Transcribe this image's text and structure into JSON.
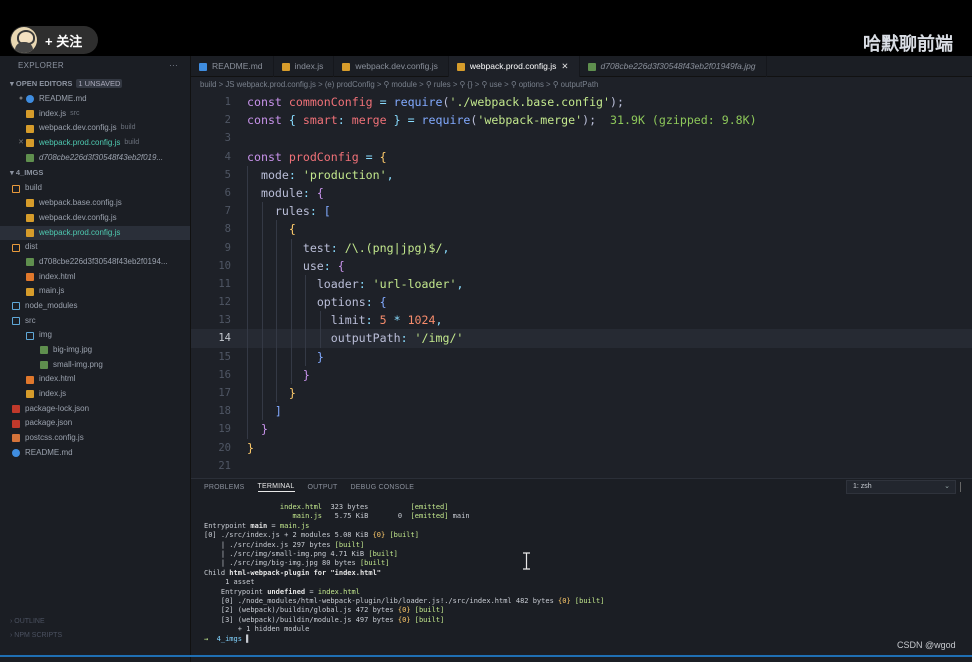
{
  "follow": {
    "label": "+ 关注"
  },
  "watermark": "哈默聊前端",
  "footer_credit": "CSDN @wgod",
  "sidebar": {
    "title": "EXPLORER",
    "more": "···",
    "open_editors": {
      "label": "OPEN EDITORS",
      "badge": "1 UNSAVED",
      "items": [
        {
          "mark": "●",
          "icon": "info-icon",
          "name": "README.md",
          "detail": ""
        },
        {
          "mark": "",
          "icon": "js-icon",
          "name": "index.js",
          "detail": "src"
        },
        {
          "mark": "",
          "icon": "js-icon",
          "name": "webpack.dev.config.js",
          "detail": "build"
        },
        {
          "mark": "✕",
          "icon": "js-icon",
          "name": "webpack.prod.config.js",
          "detail": "build"
        },
        {
          "mark": "",
          "icon": "image-icon",
          "name": "d708cbe226d3f30548f43eb2f019...",
          "detail": ""
        }
      ]
    },
    "project": {
      "label": "4_IMGS",
      "items": [
        {
          "indent": 0,
          "icon": "folder-icon",
          "name": "build"
        },
        {
          "indent": 1,
          "icon": "js-icon",
          "name": "webpack.base.config.js"
        },
        {
          "indent": 1,
          "icon": "js-icon",
          "name": "webpack.dev.config.js"
        },
        {
          "indent": 1,
          "icon": "js-icon",
          "name": "webpack.prod.config.js",
          "active": true
        },
        {
          "indent": 0,
          "icon": "folder-icon",
          "name": "dist"
        },
        {
          "indent": 1,
          "icon": "image-icon",
          "name": "d708cbe226d3f30548f43eb2f0194..."
        },
        {
          "indent": 1,
          "icon": "html-icon",
          "name": "index.html"
        },
        {
          "indent": 1,
          "icon": "js-icon",
          "name": "main.js"
        },
        {
          "indent": 0,
          "icon": "folder-icon",
          "name": "node_modules"
        },
        {
          "indent": 0,
          "icon": "folder-icon",
          "name": "src"
        },
        {
          "indent": 1,
          "icon": "folder-icon",
          "name": "img"
        },
        {
          "indent": 2,
          "icon": "image-icon",
          "name": "big-img.jpg"
        },
        {
          "indent": 2,
          "icon": "image-icon",
          "name": "small-img.png"
        },
        {
          "indent": 1,
          "icon": "html-icon",
          "name": "index.html"
        },
        {
          "indent": 1,
          "icon": "js-icon",
          "name": "index.js"
        },
        {
          "indent": 0,
          "icon": "npm-icon",
          "name": "package-lock.json"
        },
        {
          "indent": 0,
          "icon": "npm-icon",
          "name": "package.json"
        },
        {
          "indent": 0,
          "icon": "config-icon",
          "name": "postcss.config.js"
        },
        {
          "indent": 0,
          "icon": "info-icon",
          "name": "README.md"
        }
      ]
    },
    "outline": "OUTLINE",
    "npm_scripts": "NPM SCRIPTS"
  },
  "tabs": [
    {
      "icon": "info-icon",
      "label": "README.md",
      "active": false
    },
    {
      "icon": "js-icon",
      "label": "index.js",
      "active": false
    },
    {
      "icon": "js-icon",
      "label": "webpack.dev.config.js",
      "active": false
    },
    {
      "icon": "js-icon",
      "label": "webpack.prod.config.js",
      "active": true,
      "close": "✕"
    },
    {
      "icon": "image-icon",
      "label": "d708cbe226d3f30548f43eb2f01949fa.jpg",
      "active": false,
      "italic": true
    }
  ],
  "breadcrumb": "build > JS webpack.prod.config.js > (e) prodConfig > ⚲ module > ⚲ rules > ⚲ {} > ⚲ use > ⚲ options > ⚲ outputPath",
  "code": {
    "current_line": 14,
    "lines": [
      {
        "n": 1,
        "indent": 0,
        "tokens": [
          [
            "k",
            "const "
          ],
          [
            "v",
            "commonConfig"
          ],
          [
            "p",
            " = "
          ],
          [
            "f",
            "require"
          ],
          [
            "w",
            "("
          ],
          [
            "s",
            "'./webpack.base.config'"
          ],
          [
            "w",
            ");"
          ]
        ]
      },
      {
        "n": 2,
        "indent": 0,
        "tokens": [
          [
            "k",
            "const "
          ],
          [
            "p",
            "{ "
          ],
          [
            "v",
            "smart"
          ],
          [
            "p",
            ": "
          ],
          [
            "v",
            "merge"
          ],
          [
            "p",
            " } = "
          ],
          [
            "f",
            "require"
          ],
          [
            "w",
            "("
          ],
          [
            "s",
            "'webpack-merge'"
          ],
          [
            "w",
            ");"
          ],
          [
            "hint",
            "  31.9K (gzipped: 9.8K)"
          ]
        ]
      },
      {
        "n": 3,
        "indent": 0,
        "tokens": []
      },
      {
        "n": 4,
        "indent": 0,
        "tokens": [
          [
            "k",
            "const "
          ],
          [
            "v",
            "prodConfig"
          ],
          [
            "p",
            " = "
          ],
          [
            "y",
            "{"
          ]
        ]
      },
      {
        "n": 5,
        "indent": 1,
        "tokens": [
          [
            "w",
            "mode"
          ],
          [
            "p",
            ": "
          ],
          [
            "s",
            "'production'"
          ],
          [
            "p",
            ","
          ]
        ]
      },
      {
        "n": 6,
        "indent": 1,
        "tokens": [
          [
            "w",
            "module"
          ],
          [
            "p",
            ": "
          ],
          [
            "k",
            "{"
          ]
        ]
      },
      {
        "n": 7,
        "indent": 2,
        "tokens": [
          [
            "w",
            "rules"
          ],
          [
            "p",
            ": "
          ],
          [
            "f",
            "["
          ]
        ]
      },
      {
        "n": 8,
        "indent": 3,
        "tokens": [
          [
            "y",
            "{"
          ]
        ]
      },
      {
        "n": 9,
        "indent": 4,
        "tokens": [
          [
            "w",
            "test"
          ],
          [
            "p",
            ": "
          ],
          [
            "re",
            "/\\.(png|jpg)$/"
          ],
          [
            "p",
            ","
          ]
        ]
      },
      {
        "n": 10,
        "indent": 4,
        "tokens": [
          [
            "w",
            "use"
          ],
          [
            "p",
            ": "
          ],
          [
            "k",
            "{"
          ]
        ]
      },
      {
        "n": 11,
        "indent": 5,
        "tokens": [
          [
            "w",
            "loader"
          ],
          [
            "p",
            ": "
          ],
          [
            "s",
            "'url-loader'"
          ],
          [
            "p",
            ","
          ]
        ]
      },
      {
        "n": 12,
        "indent": 5,
        "tokens": [
          [
            "w",
            "options"
          ],
          [
            "p",
            ": "
          ],
          [
            "f",
            "{"
          ]
        ]
      },
      {
        "n": 13,
        "indent": 6,
        "tokens": [
          [
            "w",
            "limit"
          ],
          [
            "p",
            ": "
          ],
          [
            "n",
            "5"
          ],
          [
            "p",
            " * "
          ],
          [
            "n",
            "1024"
          ],
          [
            "p",
            ","
          ]
        ]
      },
      {
        "n": 14,
        "indent": 6,
        "tokens": [
          [
            "w",
            "outputPath"
          ],
          [
            "p",
            ": "
          ],
          [
            "s",
            "'/img/'"
          ]
        ]
      },
      {
        "n": 15,
        "indent": 5,
        "tokens": [
          [
            "f",
            "}"
          ]
        ]
      },
      {
        "n": 16,
        "indent": 4,
        "tokens": [
          [
            "k",
            "}"
          ]
        ]
      },
      {
        "n": 17,
        "indent": 3,
        "tokens": [
          [
            "y",
            "}"
          ]
        ]
      },
      {
        "n": 18,
        "indent": 2,
        "tokens": [
          [
            "f",
            "]"
          ]
        ]
      },
      {
        "n": 19,
        "indent": 1,
        "tokens": [
          [
            "k",
            "}"
          ]
        ]
      },
      {
        "n": 20,
        "indent": 0,
        "tokens": [
          [
            "y",
            "}"
          ]
        ]
      },
      {
        "n": 21,
        "indent": 0,
        "tokens": []
      }
    ]
  },
  "panel": {
    "tabs": [
      "PROBLEMS",
      "TERMINAL",
      "OUTPUT",
      "DEBUG CONSOLE"
    ],
    "active_tab": "TERMINAL",
    "shell": "1: zsh",
    "terminal_lines": [
      [
        [
          "tg",
          "                  index.html"
        ],
        [
          "",
          "  323 bytes          "
        ],
        [
          "tg",
          "[emitted]"
        ]
      ],
      [
        [
          "tg",
          "                     main.js"
        ],
        [
          "",
          "   5.75 KiB       0  "
        ],
        [
          "tg",
          "[emitted]"
        ],
        [
          "",
          " main"
        ]
      ],
      [
        [
          "",
          "Entrypoint "
        ],
        [
          "tbold",
          "main"
        ],
        [
          "",
          " = "
        ],
        [
          "tg",
          "main.js"
        ]
      ],
      [
        [
          "",
          "[0] ./src/index.js + 2 modules 5.08 KiB "
        ],
        [
          "ty",
          "{0}"
        ],
        [
          "",
          " "
        ],
        [
          "tg",
          "[built]"
        ]
      ],
      [
        [
          "",
          "    | ./src/index.js 297 bytes "
        ],
        [
          "tg",
          "[built]"
        ]
      ],
      [
        [
          "",
          "    | ./src/img/small-img.png 4.71 KiB "
        ],
        [
          "tg",
          "[built]"
        ]
      ],
      [
        [
          "",
          "    | ./src/img/big-img.jpg 80 bytes "
        ],
        [
          "tg",
          "[built]"
        ]
      ],
      [
        [
          "",
          "Child "
        ],
        [
          "tbold",
          "html-webpack-plugin for \"index.html\""
        ],
        [
          ":"
        ]
      ],
      [
        [
          "",
          "     1 asset"
        ]
      ],
      [
        [
          "",
          "    Entrypoint "
        ],
        [
          "tbold",
          "undefined"
        ],
        [
          "",
          " = "
        ],
        [
          "tg",
          "index.html"
        ]
      ],
      [
        [
          "",
          "    [0] ./node_modules/html-webpack-plugin/lib/loader.js!./src/index.html 482 bytes "
        ],
        [
          "ty",
          "{0}"
        ],
        [
          "",
          " "
        ],
        [
          "tg",
          "[built]"
        ]
      ],
      [
        [
          "",
          "    [2] (webpack)/buildin/global.js 472 bytes "
        ],
        [
          "ty",
          "{0}"
        ],
        [
          "",
          " "
        ],
        [
          "tg",
          "[built]"
        ]
      ],
      [
        [
          "",
          "    [3] (webpack)/buildin/module.js 497 bytes "
        ],
        [
          "ty",
          "{0}"
        ],
        [
          "",
          " "
        ],
        [
          "tg",
          "[built]"
        ]
      ],
      [
        [
          "",
          "        + 1 hidden module"
        ]
      ],
      [
        [
          "tg",
          "→  "
        ],
        [
          "tb",
          "4_imgs"
        ],
        [
          "",
          " ▌"
        ]
      ]
    ]
  },
  "colors": {
    "accent": "#1f6fb3",
    "editor_bg": "#1e2128",
    "sidebar_bg": "#1b1e24"
  }
}
